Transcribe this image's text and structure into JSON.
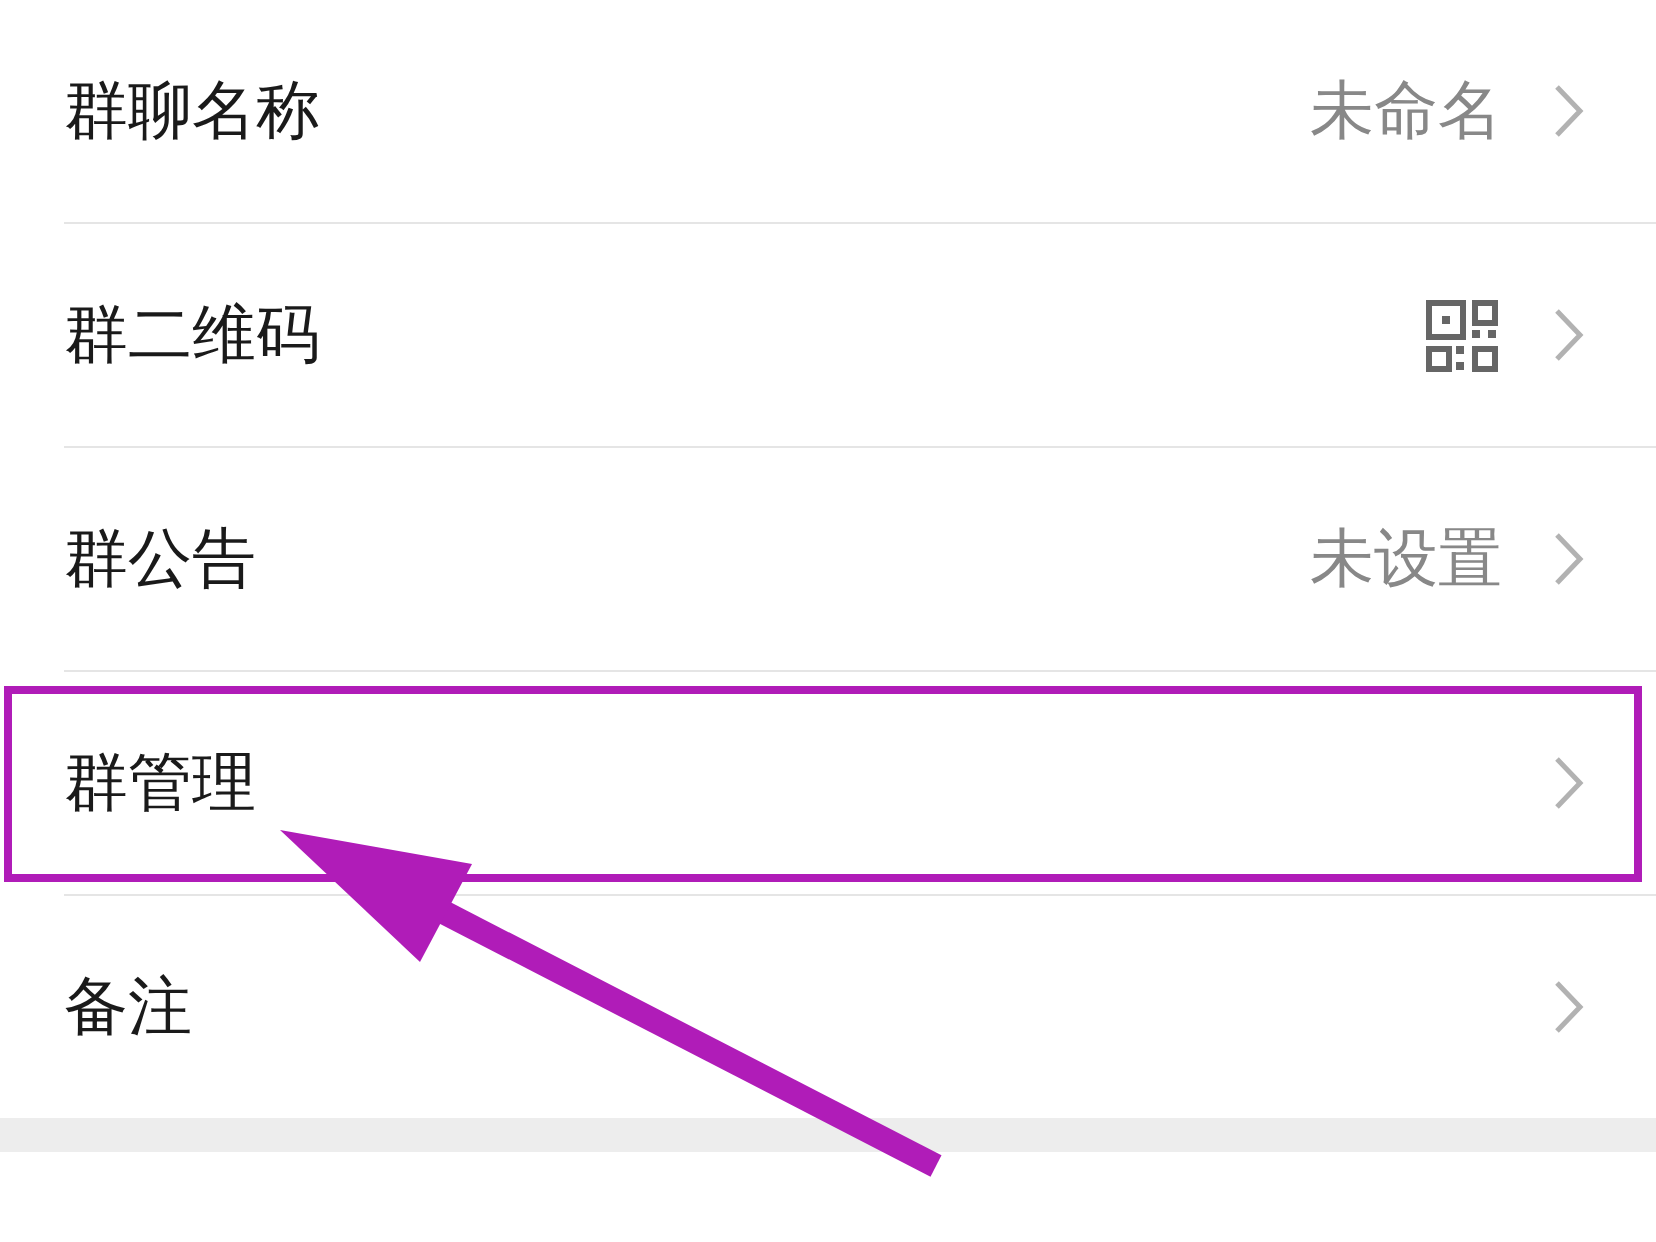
{
  "groups": [
    {
      "rows": [
        {
          "kind": "value",
          "label": "群聊名称",
          "value": "未命名",
          "highlighted": false
        },
        {
          "kind": "qr",
          "label": "群二维码",
          "highlighted": false
        },
        {
          "kind": "value",
          "label": "群公告",
          "value": "未设置",
          "highlighted": false
        },
        {
          "kind": "plain",
          "label": "群管理",
          "highlighted": true
        },
        {
          "kind": "plain",
          "label": "备注",
          "highlighted": false
        }
      ]
    },
    {
      "rows": [
        {
          "kind": "blank",
          "highlighted": false
        }
      ]
    }
  ]
}
